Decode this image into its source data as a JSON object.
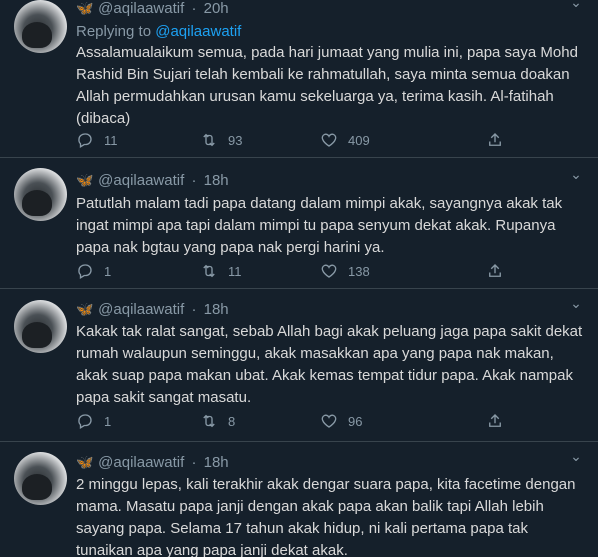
{
  "tweets": [
    {
      "handle": "@aqilaawatif",
      "time": "20h",
      "reply_prefix": "Replying to ",
      "reply_to": "@aqilaawatif",
      "text": "Assalamualaikum semua, pada hari jumaat yang mulia ini, papa saya Mohd Rashid Bin Sujari telah kembali ke rahmatullah, saya minta semua doakan Allah permudahkan urusan kamu sekeluarga ya, terima kasih. Al-fatihah (dibaca)",
      "replies": "11",
      "retweets": "93",
      "likes": "409"
    },
    {
      "handle": "@aqilaawatif",
      "time": "18h",
      "text": "Patutlah malam tadi papa datang dalam mimpi akak, sayangnya akak tak ingat mimpi apa tapi dalam mimpi tu papa senyum dekat akak. Rupanya papa nak bgtau yang papa nak pergi harini ya.",
      "replies": "1",
      "retweets": "11",
      "likes": "138"
    },
    {
      "handle": "@aqilaawatif",
      "time": "18h",
      "text": "Kakak tak ralat sangat, sebab Allah bagi akak peluang jaga papa sakit dekat rumah walaupun seminggu, akak masakkan apa yang papa nak makan, akak suap papa makan ubat. Akak kemas tempat tidur papa. Akak nampak papa sakit sangat masatu.",
      "replies": "1",
      "retweets": "8",
      "likes": "96"
    },
    {
      "handle": "@aqilaawatif",
      "time": "18h",
      "text": "2 minggu lepas, kali terakhir akak dengar suara papa, kita facetime dengan mama. Masatu papa janji dengan akak papa akan balik tapi Allah lebih sayang papa. Selama 17 tahun akak hidup, ni kali pertama papa tak tunaikan apa yang papa janji dekat akak."
    }
  ],
  "icons": {
    "verified_emoji": "butterfly-icon",
    "menu": "chevron-down-icon",
    "reply": "reply-icon",
    "retweet": "retweet-icon",
    "like": "heart-icon",
    "share": "share-icon"
  },
  "colors": {
    "background": "#15202b",
    "text": "#d9d9d9",
    "muted": "#8899a6",
    "accent": "#1da1f2",
    "divider": "#38444d"
  },
  "symbols": {
    "dot": "·",
    "butterfly": "🦋",
    "caret": "⌄"
  }
}
